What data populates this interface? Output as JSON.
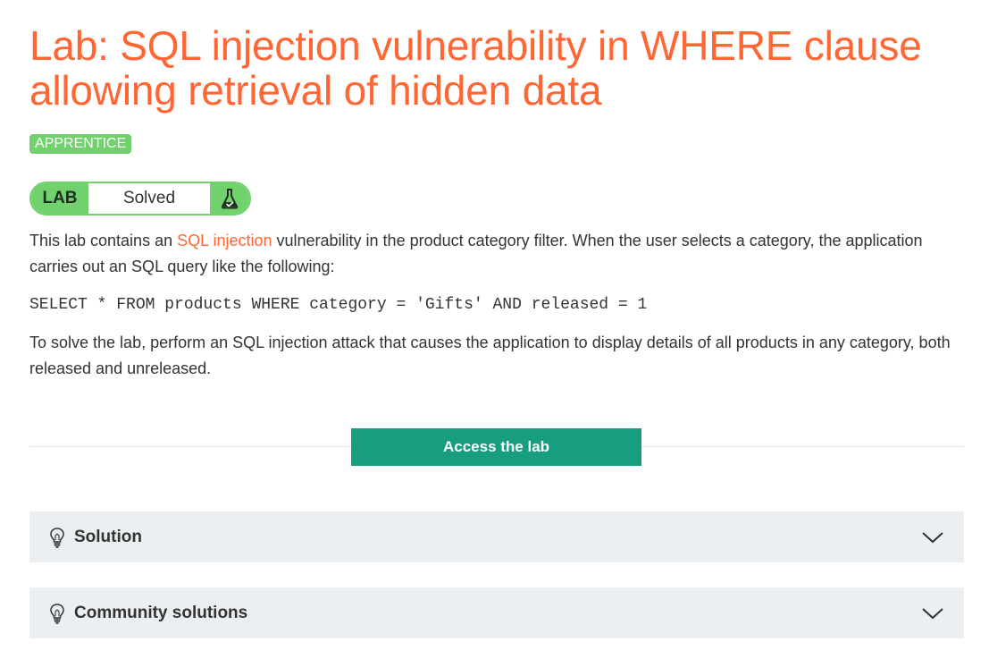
{
  "header": {
    "title": "Lab: SQL injection vulnerability in WHERE clause allowing retrieval of hidden data",
    "level_badge": "APPRENTICE"
  },
  "status": {
    "tag": "LAB",
    "state": "Solved",
    "icon": "flask-check-icon"
  },
  "description": {
    "p1_before": "This lab contains an ",
    "p1_link": "SQL injection",
    "p1_after": " vulnerability in the product category filter. When the user selects a category, the application carries out an SQL query like the following:",
    "code": "SELECT * FROM products WHERE category = 'Gifts' AND released = 1",
    "p2": "To solve the lab, perform an SQL injection attack that causes the application to display details of all products in any category, both released and unreleased."
  },
  "actions": {
    "access_label": "Access the lab"
  },
  "accordions": [
    {
      "label": "Solution",
      "icon": "lightbulb-icon"
    },
    {
      "label": "Community solutions",
      "icon": "lightbulb-icon"
    }
  ],
  "colors": {
    "title": "#ff6633",
    "link": "#ff6633",
    "badge": "#70d16d",
    "button": "#179e81",
    "accordion_bg": "#ebeff2"
  }
}
